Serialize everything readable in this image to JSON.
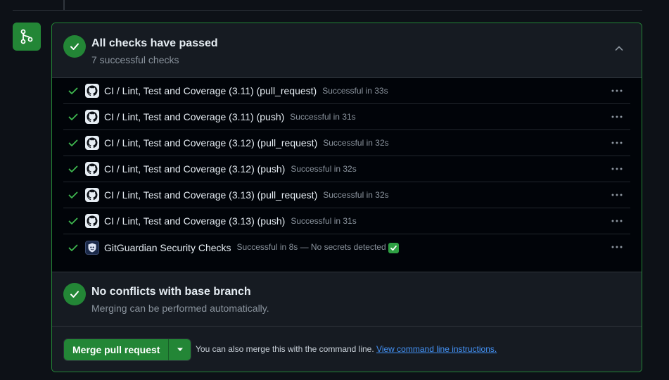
{
  "colors": {
    "success": "#238636",
    "check_green": "#3fb950",
    "border": "#30363d",
    "muted_text": "#8b949e",
    "link": "#4493f8"
  },
  "icons": {
    "merge_badge": "git-merge-icon",
    "status": "check-circle-icon",
    "collapse": "chevron-up-icon",
    "row_status": "check-icon",
    "github_app": "github-icon",
    "gitguardian_app": "gitguardian-icon",
    "row_menu": "kebab-horizontal-icon",
    "dropdown": "triangle-down-icon"
  },
  "checks_summary": {
    "title": "All checks have passed",
    "subtitle": "7 successful checks"
  },
  "checks": [
    {
      "name": "CI / Lint, Test and Coverage (3.11) (pull_request)",
      "status": "Successful in 33s",
      "app": "github"
    },
    {
      "name": "CI / Lint, Test and Coverage (3.11) (push)",
      "status": "Successful in 31s",
      "app": "github"
    },
    {
      "name": "CI / Lint, Test and Coverage (3.12) (pull_request)",
      "status": "Successful in 32s",
      "app": "github"
    },
    {
      "name": "CI / Lint, Test and Coverage (3.12) (push)",
      "status": "Successful in 32s",
      "app": "github"
    },
    {
      "name": "CI / Lint, Test and Coverage (3.13) (pull_request)",
      "status": "Successful in 32s",
      "app": "github"
    },
    {
      "name": "CI / Lint, Test and Coverage (3.13) (push)",
      "status": "Successful in 31s",
      "app": "github"
    },
    {
      "name": "GitGuardian Security Checks",
      "status": "Successful in 8s — No secrets detected",
      "app": "gitguardian",
      "emoji": "white-check-mark"
    }
  ],
  "conflicts": {
    "title": "No conflicts with base branch",
    "subtitle": "Merging can be performed automatically."
  },
  "merge": {
    "button_label": "Merge pull request",
    "note_text": "You can also merge this with the command line.",
    "link_text": "View command line instructions."
  }
}
